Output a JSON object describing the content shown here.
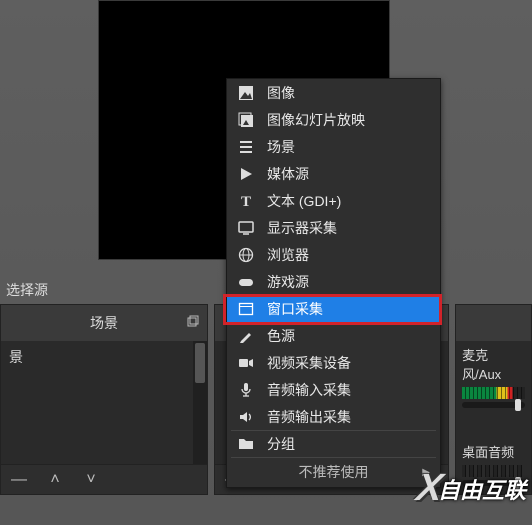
{
  "hint": "选择源",
  "panels": {
    "scenes": {
      "title": "场景",
      "items": [
        "景"
      ]
    },
    "sources": {
      "title": ""
    },
    "mixer": {
      "mic_label": "麦克风/Aux",
      "desktop_label": "桌面音频"
    }
  },
  "toolbar": {
    "minus": "—",
    "up": "˄",
    "down": "˅"
  },
  "menu": {
    "items": [
      {
        "icon": "image-icon",
        "label": "图像"
      },
      {
        "icon": "slideshow-icon",
        "label": "图像幻灯片放映"
      },
      {
        "icon": "scene-icon",
        "label": "场景"
      },
      {
        "icon": "media-icon",
        "label": "媒体源"
      },
      {
        "icon": "text-icon",
        "label": "文本 (GDI+)"
      },
      {
        "icon": "display-icon",
        "label": "显示器采集"
      },
      {
        "icon": "browser-icon",
        "label": "浏览器"
      },
      {
        "icon": "game-icon",
        "label": "游戏源"
      },
      {
        "icon": "window-icon",
        "label": "窗口采集",
        "highlight": true
      },
      {
        "icon": "color-icon",
        "label": "色源"
      },
      {
        "icon": "video-icon",
        "label": "视频采集设备"
      },
      {
        "icon": "audio-in-icon",
        "label": "音频输入采集"
      },
      {
        "icon": "audio-out-icon",
        "label": "音频输出采集"
      },
      {
        "icon": "group-icon",
        "label": "分组",
        "sep": true
      }
    ],
    "deprecated": "不推荐使用"
  },
  "watermark": "自由互联"
}
